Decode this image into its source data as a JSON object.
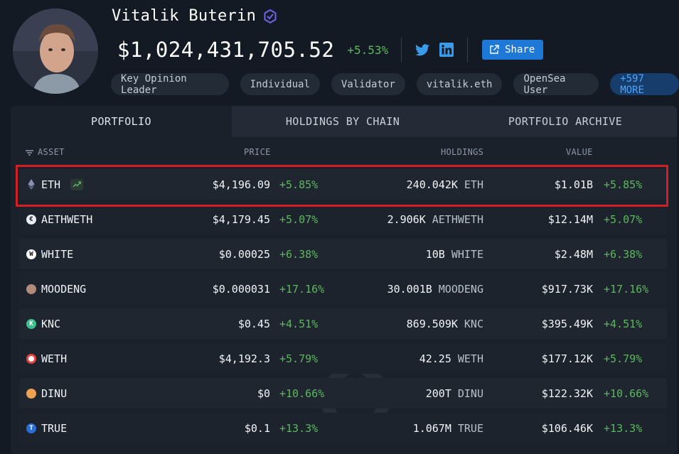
{
  "profile": {
    "name": "Vitalik Buterin",
    "total_value": "$1,024,431,705.52",
    "total_change": "+5.53%",
    "share_label": "Share",
    "tags": [
      {
        "label": "Key Opinion Leader"
      },
      {
        "label": "Individual"
      },
      {
        "label": "Validator"
      },
      {
        "label": "vitalik.eth"
      },
      {
        "label": "OpenSea User"
      },
      {
        "label": "+597 MORE"
      }
    ]
  },
  "tabs": [
    {
      "label": "PORTFOLIO",
      "active": true
    },
    {
      "label": "HOLDINGS BY CHAIN",
      "active": false
    },
    {
      "label": "PORTFOLIO ARCHIVE",
      "active": false
    }
  ],
  "columns": {
    "asset": "ASSET",
    "price": "PRICE",
    "holdings": "HOLDINGS",
    "value": "VALUE"
  },
  "rows": [
    {
      "symbol": "ETH",
      "icon": "eth-icon",
      "price": "$4,196.09",
      "price_change": "+5.85%",
      "holdings": "240.042K",
      "unit": "ETH",
      "value": "$1.01B",
      "value_change": "+5.85%"
    },
    {
      "symbol": "AETHWETH",
      "icon": "aethweth-icon",
      "price": "$4,179.45",
      "price_change": "+5.07%",
      "holdings": "2.906K",
      "unit": "AETHWETH",
      "value": "$12.14M",
      "value_change": "+5.07%"
    },
    {
      "symbol": "WHITE",
      "icon": "white-icon",
      "price": "$0.00025",
      "price_change": "+6.38%",
      "holdings": "10B",
      "unit": "WHITE",
      "value": "$2.48M",
      "value_change": "+6.38%"
    },
    {
      "symbol": "MOODENG",
      "icon": "moodeng-icon",
      "price": "$0.000031",
      "price_change": "+17.16%",
      "holdings": "30.001B",
      "unit": "MOODENG",
      "value": "$917.73K",
      "value_change": "+17.16%"
    },
    {
      "symbol": "KNC",
      "icon": "knc-icon",
      "price": "$0.45",
      "price_change": "+4.51%",
      "holdings": "869.509K",
      "unit": "KNC",
      "value": "$395.49K",
      "value_change": "+4.51%"
    },
    {
      "symbol": "WETH",
      "icon": "weth-icon",
      "price": "$4,192.3",
      "price_change": "+5.79%",
      "holdings": "42.25",
      "unit": "WETH",
      "value": "$177.12K",
      "value_change": "+5.79%"
    },
    {
      "symbol": "DINU",
      "icon": "dinu-icon",
      "price": "$0",
      "price_change": "+10.66%",
      "holdings": "200T",
      "unit": "DINU",
      "value": "$122.32K",
      "value_change": "+10.66%"
    },
    {
      "symbol": "TRUE",
      "icon": "true-icon",
      "price": "$0.1",
      "price_change": "+13.3%",
      "holdings": "1.067M",
      "unit": "TRUE",
      "value": "$106.46K",
      "value_change": "+13.3%"
    }
  ],
  "colors": {
    "background": "#141a23",
    "positive": "#5cb85c",
    "accent": "#1d78d6",
    "highlight": "#d21f26"
  }
}
